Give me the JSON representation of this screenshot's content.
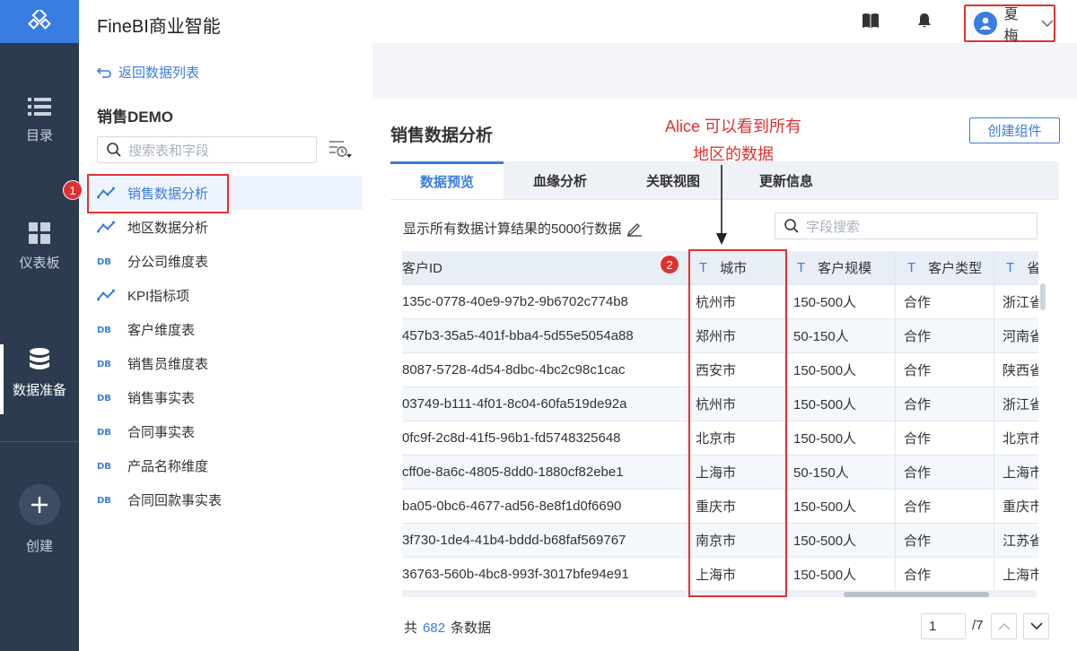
{
  "app": {
    "title": "FineBI商业智能"
  },
  "nav": {
    "items": [
      {
        "label": "目录"
      },
      {
        "label": "仪表板"
      },
      {
        "label": "数据准备"
      },
      {
        "label": "创建"
      }
    ]
  },
  "user": {
    "name": "夏梅"
  },
  "side": {
    "back_label": "返回数据列表",
    "package_title": "销售DEMO",
    "search_placeholder": "搜索表和字段",
    "tables": [
      {
        "label": "销售数据分析",
        "icon": "analysis"
      },
      {
        "label": "地区数据分析",
        "icon": "analysis"
      },
      {
        "label": "分公司维度表",
        "icon": "db"
      },
      {
        "label": "KPI指标项",
        "icon": "analysis"
      },
      {
        "label": "客户维度表",
        "icon": "db"
      },
      {
        "label": "销售员维度表",
        "icon": "db"
      },
      {
        "label": "销售事实表",
        "icon": "db"
      },
      {
        "label": "合同事实表",
        "icon": "db"
      },
      {
        "label": "产品名称维度",
        "icon": "db"
      },
      {
        "label": "合同回款事实表",
        "icon": "db"
      }
    ]
  },
  "main": {
    "title": "销售数据分析",
    "create_label": "创建组件",
    "tabs": [
      {
        "label": "数据预览"
      },
      {
        "label": "血缘分析"
      },
      {
        "label": "关联视图"
      },
      {
        "label": "更新信息"
      }
    ],
    "info_text": "显示所有数据计算结果的5000行数据",
    "field_search_placeholder": "字段搜索",
    "columns": [
      {
        "label": "客户ID",
        "type": ""
      },
      {
        "label": "城市",
        "type": "T"
      },
      {
        "label": "客户规模",
        "type": "T"
      },
      {
        "label": "客户类型",
        "type": "T"
      },
      {
        "label": "省",
        "type": "T"
      }
    ],
    "rows": [
      [
        "135c-0778-40e9-97b2-9b6702c774b8",
        "杭州市",
        "150-500人",
        "合作",
        "浙江省"
      ],
      [
        "457b3-35a5-401f-bba4-5d55e5054a88",
        "郑州市",
        "50-150人",
        "合作",
        "河南省"
      ],
      [
        "8087-5728-4d54-8dbc-4bc2c98c1cac",
        "西安市",
        "150-500人",
        "合作",
        "陕西省"
      ],
      [
        "03749-b111-4f01-8c04-60fa519de92a",
        "杭州市",
        "150-500人",
        "合作",
        "浙江省"
      ],
      [
        "0fc9f-2c8d-41f5-96b1-fd5748325648",
        "北京市",
        "150-500人",
        "合作",
        "北京市"
      ],
      [
        "cff0e-8a6c-4805-8dd0-1880cf82ebe1",
        "上海市",
        "50-150人",
        "合作",
        "上海市"
      ],
      [
        "ba05-0bc6-4677-ad56-8e8f1d0f6690",
        "重庆市",
        "150-500人",
        "合作",
        "重庆市"
      ],
      [
        "3f730-1de4-41b4-bddd-b68faf569767",
        "南京市",
        "150-500人",
        "合作",
        "江苏省"
      ],
      [
        "36763-560b-4bc8-993f-3017bfe94e91",
        "上海市",
        "150-500人",
        "合作",
        "上海市"
      ]
    ],
    "total_prefix": "共",
    "total_count": "682",
    "total_suffix": "条数据",
    "page_current": "1",
    "page_total": "/7"
  },
  "annotation": {
    "line1": "Alice 可以看到所有",
    "line2": "地区的数据",
    "badge1": "1",
    "badge2": "2"
  },
  "colors": {
    "accent": "#3a7de0",
    "nav_bg": "#2c3b50",
    "highlight": "#e03131"
  }
}
